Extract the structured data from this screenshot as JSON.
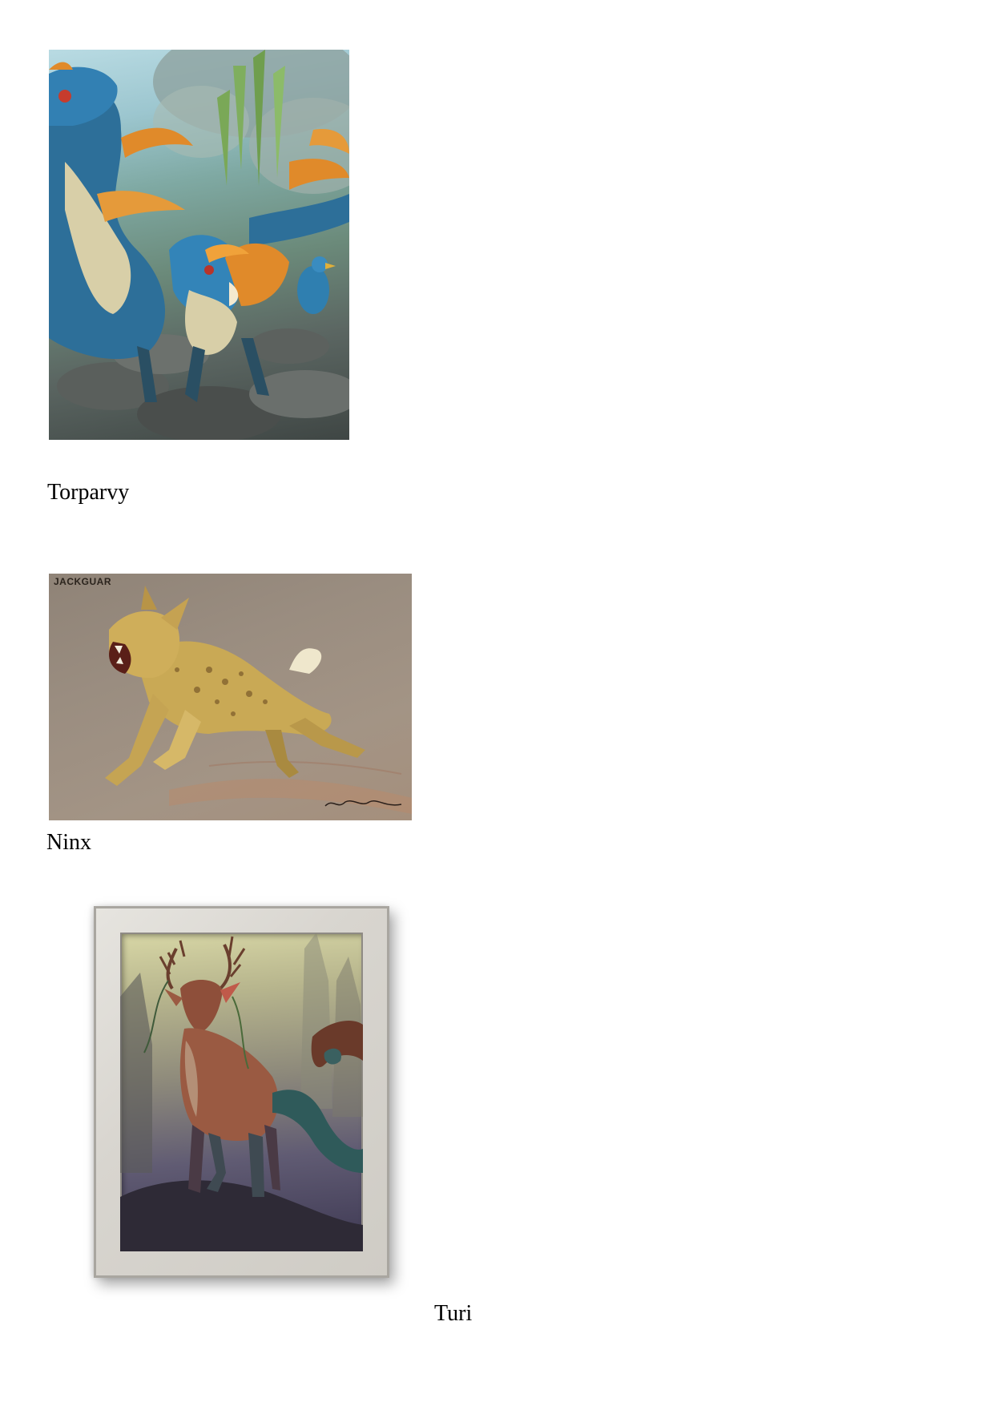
{
  "images": [
    {
      "caption": "Torparvy",
      "subject": "blue feathered raptor creatures on rocky ground",
      "accent_colors": [
        "#2f7fb0",
        "#e08a2a",
        "#d8cfa8"
      ]
    },
    {
      "caption": "Ninx",
      "subject": "spotted leaping cat-like creature with long ears",
      "wordmark": "JACKGUAR",
      "accent_colors": [
        "#c9a955",
        "#8f8377"
      ]
    },
    {
      "caption": "Turi",
      "subject": "antlered deer creature with feathered tail in a misty forest, framed",
      "accent_colors": [
        "#8e4f3a",
        "#cfccc5",
        "#5a5576"
      ]
    }
  ]
}
